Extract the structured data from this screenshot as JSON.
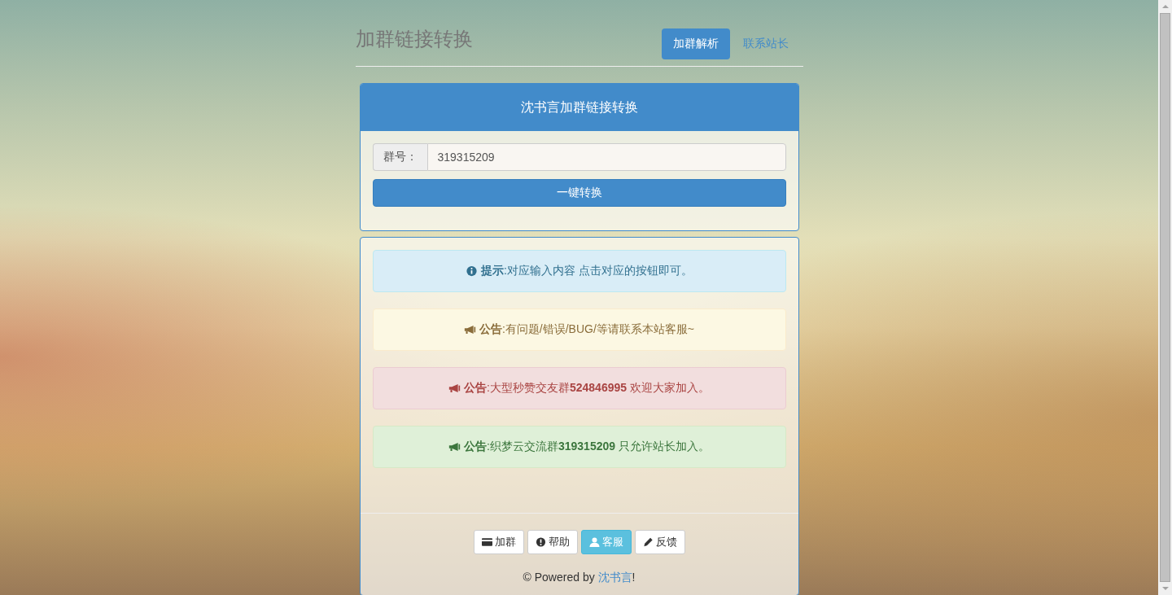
{
  "header": {
    "title": "加群链接转换",
    "nav": [
      {
        "label": "加群解析",
        "selected": true
      },
      {
        "label": "联系站长",
        "selected": false
      }
    ]
  },
  "converter": {
    "title": "沈书言加群链接转换",
    "field_label": "群号：",
    "field_value": "319315209",
    "submit": "一键转换"
  },
  "alerts": [
    {
      "kind": "info",
      "text": "**提示**:对应输入内容 点击对应的按钮即可。"
    },
    {
      "kind": "warning",
      "text": "**公告**:有问题/错误/BUG/等请联系本站客服~"
    },
    {
      "kind": "danger",
      "text": "**公告**:大型秒赞交友群**524846995** 欢迎大家加入。"
    },
    {
      "kind": "success",
      "text": "**公告**:织梦云交流群**319315209** 只允许站长加入。"
    }
  ],
  "footer_buttons": [
    {
      "kind": "card",
      "label": "加群",
      "highlighted": false
    },
    {
      "kind": "help",
      "label": "帮助",
      "highlighted": false
    },
    {
      "kind": "user",
      "label": "客服",
      "highlighted": true
    },
    {
      "kind": "edit",
      "label": "反馈",
      "highlighted": false
    }
  ],
  "footer": {
    "prefix": "© Powered by",
    "link": "沈书言",
    "suffix": "!"
  }
}
